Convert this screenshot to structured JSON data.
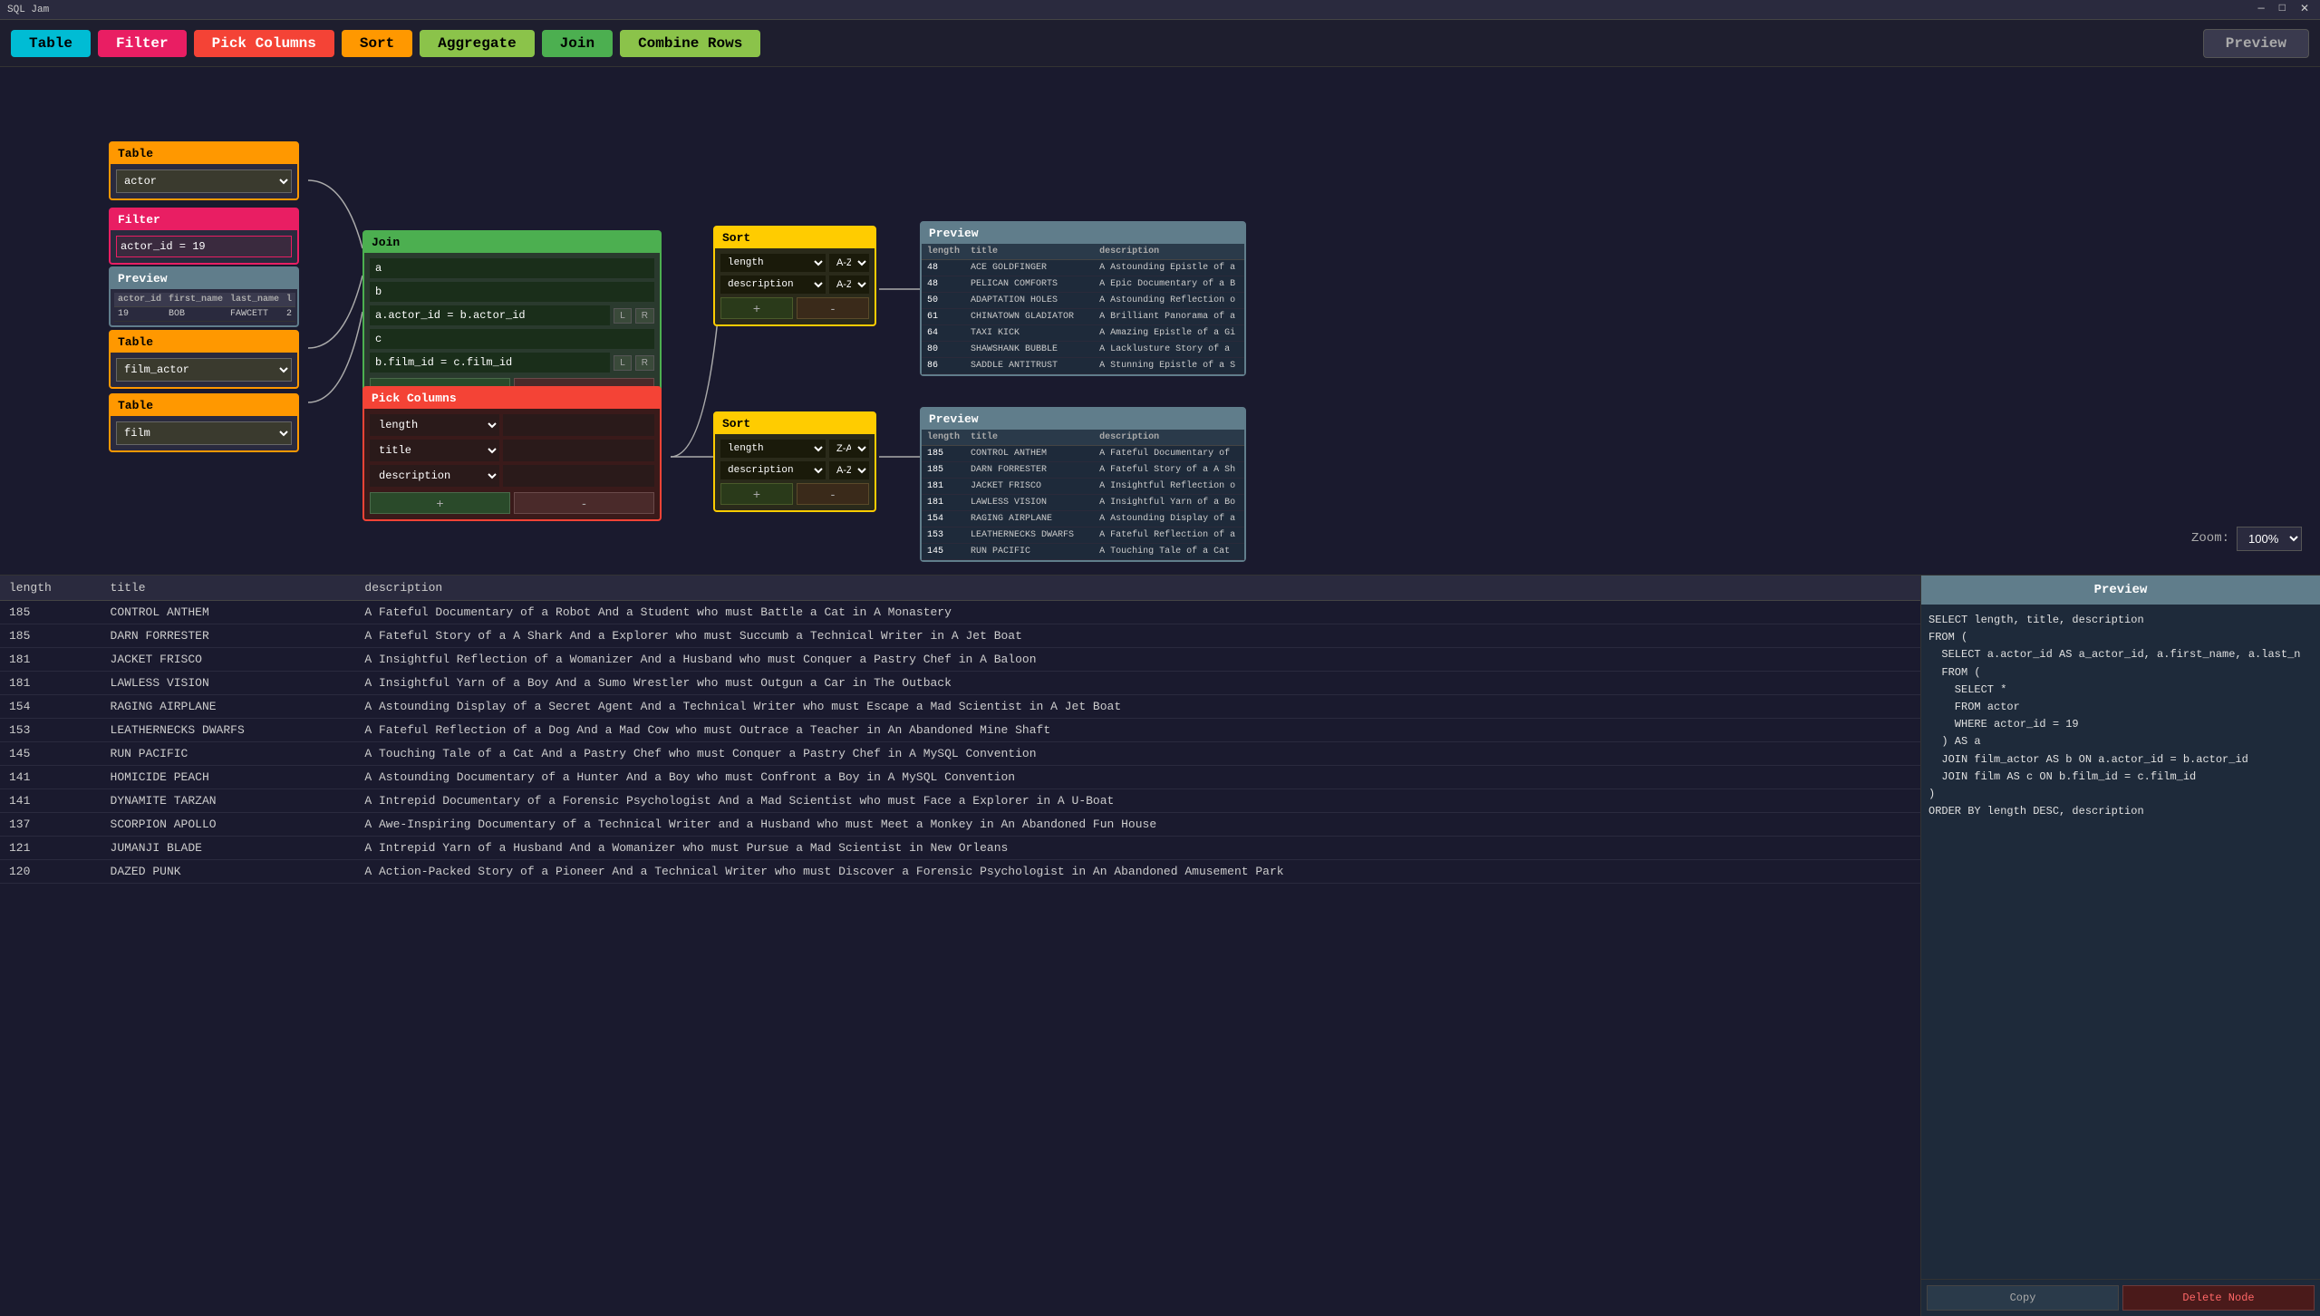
{
  "titleBar": {
    "title": "SQL Jam",
    "minimize": "—",
    "maximize": "□",
    "close": "✕"
  },
  "toolbar": {
    "table": "Table",
    "filter": "Filter",
    "pickColumns": "Pick Columns",
    "sort": "Sort",
    "aggregate": "Aggregate",
    "join": "Join",
    "combineRows": "Combine Rows",
    "preview": "Preview"
  },
  "nodes": {
    "table1": {
      "header": "Table",
      "value": "actor"
    },
    "table2": {
      "header": "Table",
      "value": "film_actor"
    },
    "table3": {
      "header": "Table",
      "value": "film"
    },
    "filter1": {
      "header": "Filter",
      "value": "actor_id = 19"
    },
    "preview1": {
      "header": "Preview",
      "columns": [
        "actor_id",
        "first_name",
        "last_name",
        "l"
      ],
      "rows": [
        [
          "19",
          "BOB",
          "FAWCETT",
          "2"
        ]
      ]
    },
    "join1": {
      "header": "Join",
      "alias1": "a",
      "alias2": "b",
      "condition1": "a.actor_id = b.actor_id",
      "alias3": "c",
      "condition2": "b.film_id = c.film_id"
    },
    "pickColumns1": {
      "header": "Pick Columns",
      "columns": [
        {
          "name": "length",
          "extra": ""
        },
        {
          "name": "title",
          "extra": ""
        },
        {
          "name": "description",
          "extra": ""
        }
      ]
    },
    "sort1": {
      "header": "Sort",
      "rows": [
        {
          "col": "length",
          "dir": "A-Z"
        },
        {
          "col": "description",
          "dir": "A-Z"
        }
      ]
    },
    "sort2": {
      "header": "Sort",
      "rows": [
        {
          "col": "length",
          "dir": "Z-A"
        },
        {
          "col": "description",
          "dir": "A-Z"
        }
      ]
    },
    "preview2": {
      "header": "Preview",
      "columns": [
        "length",
        "title",
        "description"
      ],
      "rows": [
        [
          "48",
          "ACE GOLDFINGER",
          "A Astounding Epistle of a"
        ],
        [
          "48",
          "PELICAN COMFORTS",
          "A Epic Documentary of a B"
        ],
        [
          "50",
          "ADAPTATION HOLES",
          "A Astounding Reflection o"
        ],
        [
          "61",
          "CHINATOWN GLADIATOR",
          "A Brilliant Panorama of a"
        ],
        [
          "64",
          "TAXI KICK",
          "A Amazing Epistle of a Gi"
        ],
        [
          "80",
          "SHAWSHANK BUBBLE",
          "A Lacklusture Story of a"
        ],
        [
          "86",
          "SADDLE ANTITRUST",
          "A Stunning Epistle of a S"
        ]
      ]
    },
    "preview3": {
      "header": "Preview",
      "columns": [
        "length",
        "title",
        "description"
      ],
      "rows": [
        [
          "185",
          "CONTROL ANTHEM",
          "A Fateful Documentary of"
        ],
        [
          "185",
          "DARN FORRESTER",
          "A Fateful Story of a A Sh"
        ],
        [
          "181",
          "JACKET FRISCO",
          "A Insightful Reflection o"
        ],
        [
          "181",
          "LAWLESS VISION",
          "A Insightful Yarn of a Bo"
        ],
        [
          "154",
          "RAGING AIRPLANE",
          "A Astounding Display of a"
        ],
        [
          "153",
          "LEATHERNECKS DWARFS",
          "A Fateful Reflection of a"
        ],
        [
          "145",
          "RUN PACIFIC",
          "A Touching Tale of a Cat"
        ]
      ]
    }
  },
  "zoom": {
    "label": "Zoom:",
    "value": "100%",
    "icon": "▼"
  },
  "dataTable": {
    "columns": [
      "length",
      "title",
      "description"
    ],
    "rows": [
      [
        "185",
        "CONTROL ANTHEM",
        "A Fateful Documentary of a Robot And a Student who must Battle a Cat in A Monastery"
      ],
      [
        "185",
        "DARN FORRESTER",
        "A Fateful Story of a A Shark And a Explorer who must Succumb a Technical Writer in A Jet Boat"
      ],
      [
        "181",
        "JACKET FRISCO",
        "A Insightful Reflection of a Womanizer And a Husband who must Conquer a Pastry Chef in A Baloon"
      ],
      [
        "181",
        "LAWLESS VISION",
        "A Insightful Yarn of a Boy And a Sumo Wrestler who must Outgun a Car in The Outback"
      ],
      [
        "154",
        "RAGING AIRPLANE",
        "A Astounding Display of a Secret Agent And a Technical Writer who must Escape a Mad Scientist in A Jet Boat"
      ],
      [
        "153",
        "LEATHERNECKS DWARFS",
        "A Fateful Reflection of a Dog And a Mad Cow who must Outrace a Teacher in An Abandoned Mine Shaft"
      ],
      [
        "145",
        "RUN PACIFIC",
        "A Touching Tale of a Cat And a Pastry Chef who must Conquer a Pastry Chef in A MySQL Convention"
      ],
      [
        "141",
        "HOMICIDE PEACH",
        "A Astounding Documentary of a Hunter And a Boy who must Confront a Boy in A MySQL Convention"
      ],
      [
        "141",
        "DYNAMITE TARZAN",
        "A Intrepid Documentary of a Forensic Psychologist And a Mad Scientist who must Face a Explorer in A U-Boat"
      ],
      [
        "137",
        "SCORPION APOLLO",
        "A Awe-Inspiring Documentary of a Technical Writer and a Husband who must Meet a Monkey in An Abandoned Fun House"
      ],
      [
        "121",
        "JUMANJI BLADE",
        "A Intrepid Yarn of a Husband And a Womanizer who must Pursue a Mad Scientist in New Orleans"
      ],
      [
        "120",
        "DAZED PUNK",
        "A Action-Packed Story of a Pioneer And a Technical Writer who must Discover a Forensic Psychologist in An Abandoned Amusement Park"
      ]
    ]
  },
  "previewPanel": {
    "header": "Preview",
    "sql": "SELECT length, title, description\nFROM (\n  SELECT a.actor_id AS a_actor_id, a.first_name, a.last_n\n  FROM (\n    SELECT *\n    FROM actor\n    WHERE actor_id = 19\n  ) AS a\n  JOIN film_actor AS b ON a.actor_id = b.actor_id\n  JOIN film AS c ON b.film_id = c.film_id\n)\nORDER BY length DESC, description",
    "buttons": {
      "copy": "Copy",
      "deleteNode": "Delete Node"
    }
  }
}
